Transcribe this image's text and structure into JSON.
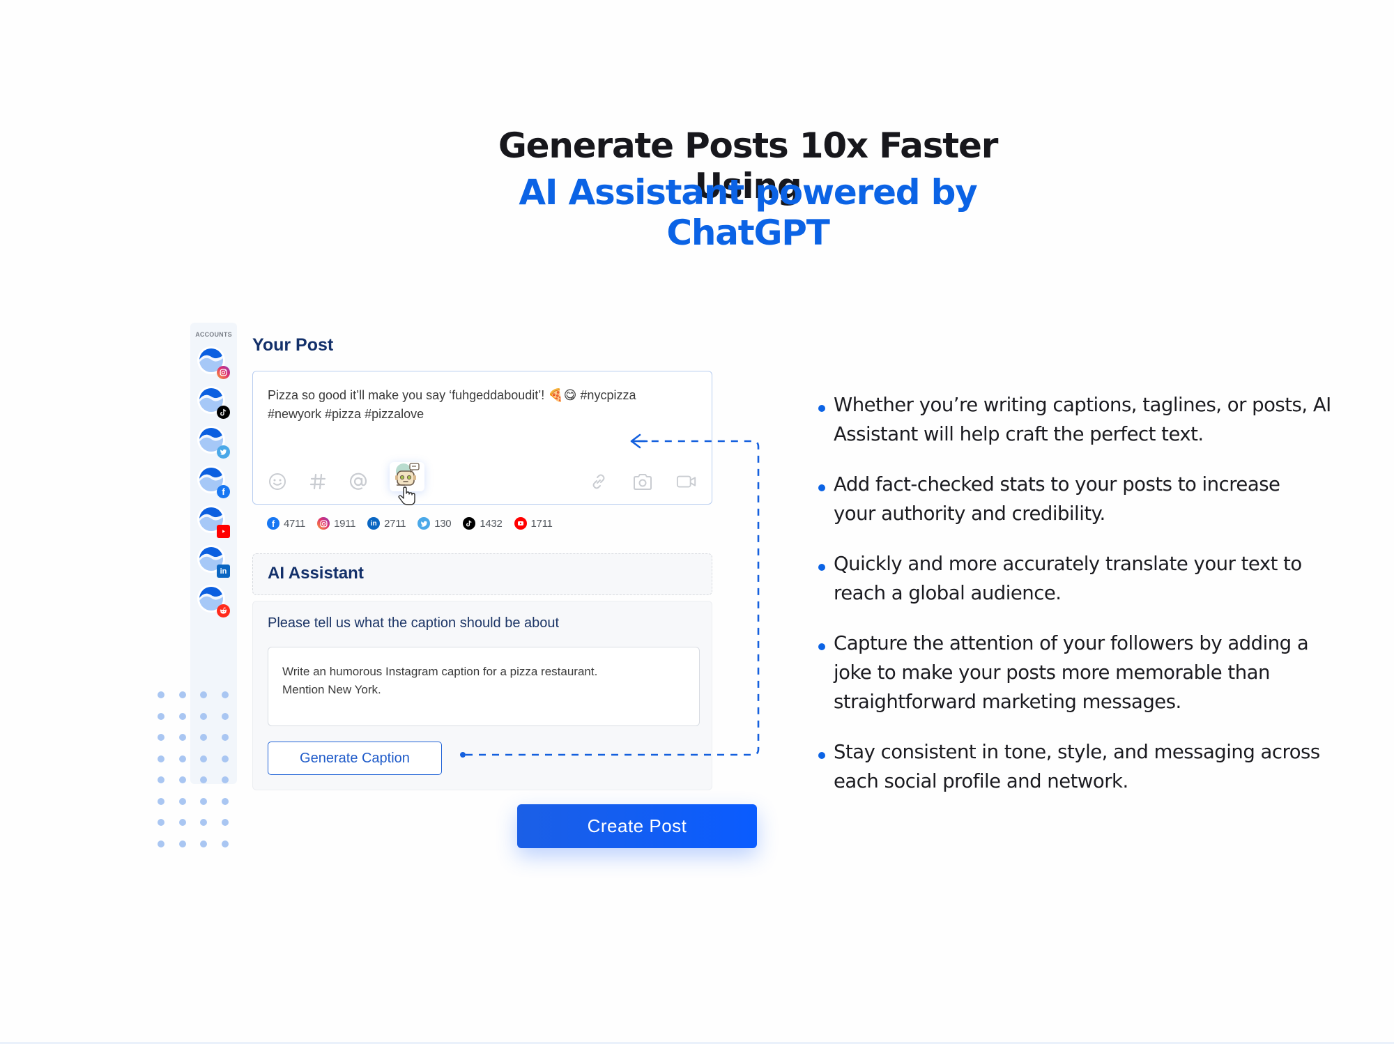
{
  "theme": {
    "accent": "#0b63e5",
    "navy": "#13306a",
    "button_blue": "#0a5cff",
    "dot_blue": "#a9c6f2"
  },
  "headline": {
    "line1": "Generate Posts 10x Faster Using",
    "line2": "AI Assistant powered by ChatGPT"
  },
  "sidebar": {
    "label": "ACCOUNTS",
    "accounts": [
      {
        "network": "instagram",
        "icon": "instagram-icon",
        "color": "#e1306c"
      },
      {
        "network": "tiktok",
        "icon": "tiktok-icon",
        "color": "#000000"
      },
      {
        "network": "twitter",
        "icon": "twitter-icon",
        "color": "#4aa8e8"
      },
      {
        "network": "facebook",
        "icon": "facebook-icon",
        "color": "#1877f2"
      },
      {
        "network": "youtube",
        "icon": "youtube-icon",
        "color": "#ff0000"
      },
      {
        "network": "linkedin",
        "icon": "linkedin-icon",
        "color": "#0a66c2"
      },
      {
        "network": "reddit",
        "icon": "reddit-icon",
        "color": "#ff2b1c"
      }
    ]
  },
  "post": {
    "title": "Your Post",
    "text_line1": "Pizza so good it’ll make you say ‘fuhgeddaboudit’! 🍕😋 #nycpizza",
    "text_line2": "#newyork #pizza #pizzalove",
    "toolbar_left": [
      "emoji-icon",
      "hashtag-icon",
      "mention-icon",
      "ai-robot-icon"
    ],
    "toolbar_right": [
      "link-icon",
      "camera-icon",
      "video-icon"
    ]
  },
  "stats": [
    {
      "network": "facebook",
      "value": "4711",
      "color": "#1877f2"
    },
    {
      "network": "instagram",
      "value": "1911",
      "color": "#e1306c"
    },
    {
      "network": "linkedin",
      "value": "2711",
      "color": "#0a66c2"
    },
    {
      "network": "twitter",
      "value": "130",
      "color": "#4aa8e8"
    },
    {
      "network": "tiktok",
      "value": "1432",
      "color": "#000000"
    },
    {
      "network": "youtube",
      "value": "1711",
      "color": "#ff0000"
    }
  ],
  "ai_assistant": {
    "title": "AI Assistant",
    "prompt_label": "Please tell us what the caption should be about",
    "prompt_line1": "Write an humorous Instagram caption for a pizza restaurant.",
    "prompt_line2": "Mention New York.",
    "generate_label": "Generate Caption"
  },
  "create_post_label": "Create Post",
  "features": [
    {
      "line1": "Whether you’re writing captions, taglines, or posts, AI",
      "line2": "Assistant will help craft the perfect text."
    },
    {
      "line1": "Add fact-checked stats to your posts to increase",
      "line2": "your authority and credibility."
    },
    {
      "line1": "Quickly and more accurately translate your text to",
      "line2": "reach a global audience."
    },
    {
      "line1": "Capture the attention of your followers by adding a",
      "line2": "joke to make your posts more memorable than",
      "line3": "straightforward marketing messages."
    },
    {
      "line1": "Stay consistent in tone, style, and messaging across",
      "line2": "each social profile and network."
    }
  ]
}
